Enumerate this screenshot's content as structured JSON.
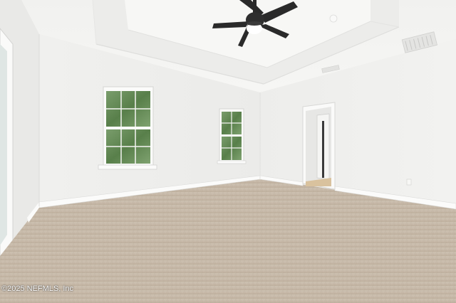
{
  "photo": {
    "subject": "empty-bedroom",
    "watermark": "©2025 NEFMLS, Inc",
    "colors": {
      "wall": "#eeeeec",
      "ceiling": "#f4f4f2",
      "carpet": "#c6b8a7",
      "trim": "#fbfbfa",
      "fan": "#2a2a2a",
      "foliage": "#5f8752",
      "doorway_floor": "#d9c29e"
    }
  }
}
